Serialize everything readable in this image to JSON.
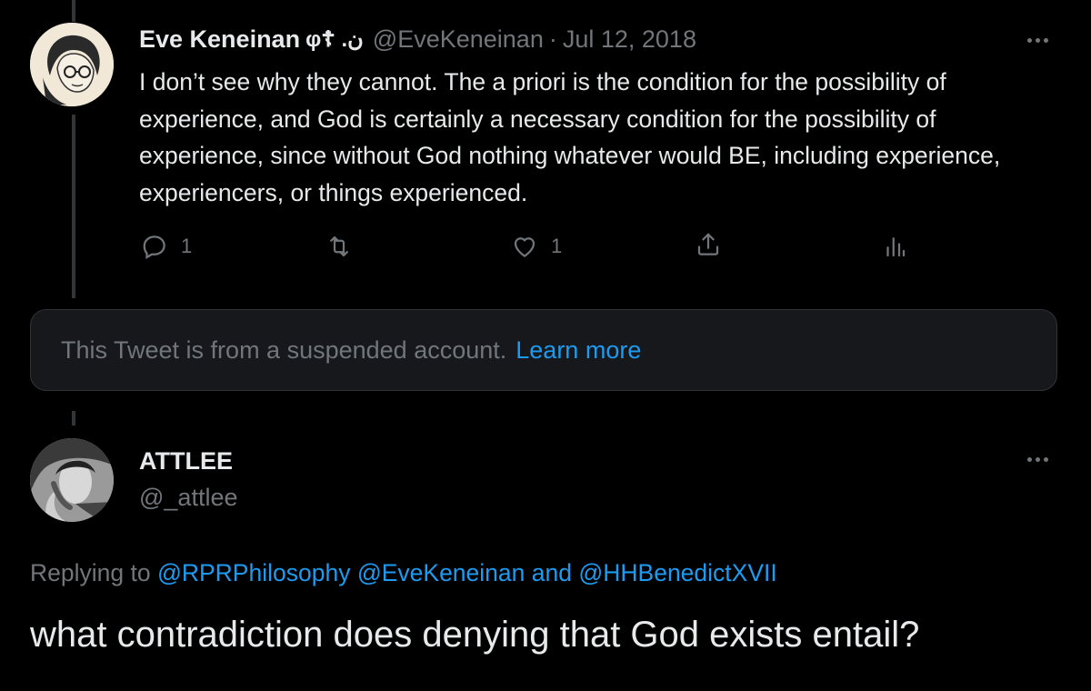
{
  "tweet1": {
    "display_name": "Eve Keneinan",
    "name_emoji": "φ☦ .ن",
    "handle": "@EveKeneinan",
    "separator": "·",
    "date": "Jul 12, 2018",
    "text": "I don’t see why they cannot. The a priori is the condition for the possibility of experience, and God is certainly a necessary condition for the possibility of experience, since without God nothing whatever would BE, including experience, experiencers, or things experienced.",
    "actions": {
      "reply_count": "1",
      "retweet_count": "",
      "like_count": "1"
    },
    "icons": [
      "more-icon",
      "reply-icon",
      "retweet-icon",
      "like-icon",
      "share-icon",
      "analytics-icon"
    ]
  },
  "suspended_notice": {
    "text": "This Tweet is from a suspended account.",
    "link": "Learn more"
  },
  "tweet2": {
    "display_name": "ATTLEE",
    "handle": "@_attlee",
    "replying_prefix": "Replying to",
    "mention1": "@RPRPhilosophy",
    "mention2": "@EveKeneinan",
    "and_word": "and",
    "mention3": "@HHBenedictXVII",
    "text": "what contradiction does denying that God exists entail?"
  },
  "colors": {
    "background": "#000000",
    "text": "#e7e9ea",
    "muted": "#71767b",
    "accent": "#1d9bf0",
    "card": "#16181c"
  }
}
